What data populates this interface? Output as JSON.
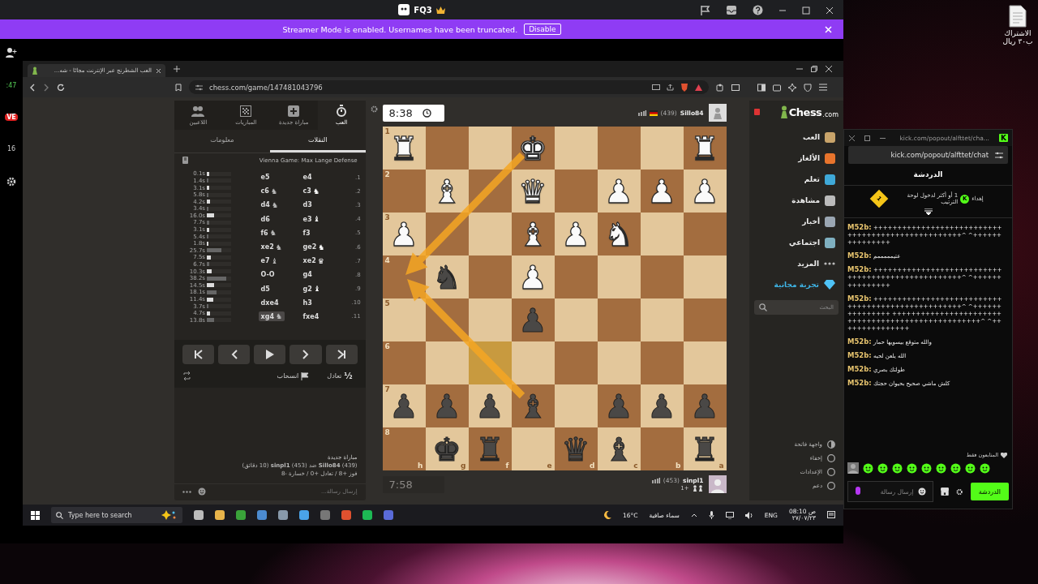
{
  "desktop_icon": {
    "label": "الاشتراك ب٣٠ ريال"
  },
  "app_window": {
    "title": "FQ3",
    "banner": {
      "text": "Streamer Mode is enabled. Usernames have been truncated.",
      "button": "Disable"
    },
    "rail": [
      {
        "kind": "time",
        "text": ":47"
      },
      {
        "kind": "live",
        "text": "VE"
      },
      {
        "kind": "count",
        "text": "16"
      }
    ]
  },
  "browser": {
    "tab_title": "العب الشطرنج عبر الإنترنت مجانًا - شه...",
    "url": "chess.com/game/147481043796"
  },
  "game_panel": {
    "nav": [
      {
        "label": "العب",
        "selected": true
      },
      {
        "label": "مباراة جديدة",
        "selected": false
      },
      {
        "label": "المباريات",
        "selected": false
      },
      {
        "label": "اللاعبين",
        "selected": false
      }
    ],
    "tabs": [
      {
        "label": "النقلات",
        "selected": true
      },
      {
        "label": "معلومات",
        "selected": false
      }
    ],
    "opening": "Vienna Game: Max Lange Defense",
    "moves": [
      {
        "number": "1.",
        "white": {
          "text": "e4",
          "selected": false
        },
        "black": {
          "text": "e5",
          "selected": false
        },
        "times": [
          {
            "text": "0.1s",
            "level": 0.1
          },
          {
            "text": "1.4s",
            "level": 0.05
          }
        ]
      },
      {
        "number": "2.",
        "white": {
          "text": "c3",
          "icon": "♞",
          "selected": false
        },
        "black": {
          "text": "c6",
          "icon": "♞",
          "selected": false
        },
        "times": [
          {
            "text": "3.1s",
            "level": 0.1
          },
          {
            "text": "5.8s",
            "level": 0.05
          }
        ]
      },
      {
        "number": "3.",
        "white": {
          "text": "d3",
          "selected": false
        },
        "black": {
          "text": "d4",
          "icon": "♞",
          "selected": false
        },
        "times": [
          {
            "text": "4.2s",
            "level": 0.12
          },
          {
            "text": "3.4s",
            "level": 0.05
          }
        ]
      },
      {
        "number": "4.",
        "white": {
          "text": "e3",
          "icon": "♝",
          "selected": false
        },
        "black": {
          "text": "d6",
          "selected": false
        },
        "times": [
          {
            "text": "16.0s",
            "level": 0.3
          },
          {
            "text": "7.7s",
            "level": 0.1
          }
        ]
      },
      {
        "number": "5.",
        "white": {
          "text": "f3",
          "selected": false
        },
        "black": {
          "text": "f6",
          "icon": "♞",
          "selected": false
        },
        "times": [
          {
            "text": "3.1s",
            "level": 0.1
          },
          {
            "text": "5.4s",
            "level": 0.05
          }
        ]
      },
      {
        "number": "6.",
        "white": {
          "text": "ge2",
          "icon": "♞",
          "selected": false
        },
        "black": {
          "text": "xe2",
          "icon": "♞",
          "selected": false
        },
        "times": [
          {
            "text": "1.8s",
            "level": 0.08
          },
          {
            "text": "25.7s",
            "level": 0.6
          }
        ]
      },
      {
        "number": "7.",
        "white": {
          "text": "xe2",
          "icon": "♛",
          "selected": false
        },
        "black": {
          "text": "e7",
          "icon": "♝",
          "selected": false
        },
        "times": [
          {
            "text": "7.5s",
            "level": 0.15
          },
          {
            "text": "6.7s",
            "level": 0.1
          }
        ]
      },
      {
        "number": "8.",
        "white": {
          "text": "g4",
          "selected": false
        },
        "black": {
          "text": "O-O",
          "selected": false
        },
        "times": [
          {
            "text": "10.3s",
            "level": 0.2
          },
          {
            "text": "38.2s",
            "level": 0.8
          }
        ]
      },
      {
        "number": "9.",
        "white": {
          "text": "g2",
          "icon": "♝",
          "selected": false
        },
        "black": {
          "text": "d5",
          "selected": false
        },
        "times": [
          {
            "text": "14.5s",
            "level": 0.3
          },
          {
            "text": "18.1s",
            "level": 0.4
          }
        ]
      },
      {
        "number": "10.",
        "white": {
          "text": "h3",
          "selected": false
        },
        "black": {
          "text": "dxe4",
          "selected": false
        },
        "times": [
          {
            "text": "11.4s",
            "level": 0.25
          },
          {
            "text": "3.7s",
            "level": 0.05
          }
        ]
      },
      {
        "number": "11.",
        "white": {
          "text": "fxe4",
          "selected": false
        },
        "black": {
          "text": "xg4",
          "icon": "♞",
          "selected": true
        },
        "times": [
          {
            "text": "4.7s",
            "level": 0.12
          },
          {
            "text": "13.8s",
            "level": 0.3
          }
        ]
      }
    ],
    "draw_icon": "½",
    "draw_label": "تعادل",
    "resign_label": "انسحاب",
    "game_info": {
      "title": "مباراة جديدة",
      "players": "**Sillo84** (439) ضد **sinpl1** (453) (10 دقائق)",
      "record": "فوز +8 / تعادل +0 / خسارة -8"
    },
    "chat_placeholder": "إرسال رسالة..."
  },
  "board": {
    "top_player": {
      "name": "Sillo84",
      "rating": "(439)",
      "clock": "8:38",
      "active": true
    },
    "bottom_player": {
      "name": "sinpl1",
      "rating": "(453)",
      "score": "1+",
      "clock": "7:58",
      "active": false
    },
    "ranks": [
      "1",
      "2",
      "3",
      "4",
      "5",
      "6",
      "7",
      "8"
    ],
    "files": [
      "a",
      "b",
      "c",
      "d",
      "e",
      "f",
      "g",
      "h"
    ],
    "squares": [
      [
        {
          "piece": "♜",
          "kind": "white",
          "highlighted": false
        },
        {
          "highlighted": false
        },
        {
          "highlighted": false
        },
        {
          "highlighted": false
        },
        {
          "piece": "♚",
          "kind": "white",
          "highlighted": false
        },
        {
          "highlighted": false
        },
        {
          "highlighted": false
        },
        {
          "piece": "♜",
          "kind": "white",
          "highlighted": false
        }
      ],
      [
        {
          "piece": "♟",
          "kind": "white",
          "highlighted": false
        },
        {
          "piece": "♟",
          "kind": "white",
          "highlighted": false
        },
        {
          "piece": "♟",
          "kind": "white",
          "highlighted": false
        },
        {
          "highlighted": false
        },
        {
          "piece": "♛",
          "kind": "white",
          "highlighted": false
        },
        {
          "highlighted": false
        },
        {
          "piece": "♝",
          "kind": "white",
          "highlighted": false
        },
        {
          "highlighted": false
        }
      ],
      [
        {
          "highlighted": false
        },
        {
          "highlighted": false
        },
        {
          "piece": "♞",
          "kind": "white",
          "highlighted": false
        },
        {
          "piece": "♟",
          "kind": "white",
          "highlighted": false
        },
        {
          "piece": "♝",
          "kind": "white",
          "highlighted": false
        },
        {
          "highlighted": false
        },
        {
          "highlighted": false
        },
        {
          "piece": "♟",
          "kind": "white",
          "highlighted": false
        }
      ],
      [
        {
          "highlighted": false
        },
        {
          "highlighted": false
        },
        {
          "highlighted": false
        },
        {
          "highlighted": false
        },
        {
          "piece": "♟",
          "kind": "white",
          "highlighted": false
        },
        {
          "highlighted": false
        },
        {
          "piece": "♞",
          "kind": "black",
          "highlighted": false
        },
        {
          "highlighted": false
        }
      ],
      [
        {
          "highlighted": false
        },
        {
          "highlighted": false
        },
        {
          "highlighted": false
        },
        {
          "highlighted": false
        },
        {
          "piece": "♟",
          "kind": "black",
          "highlighted": false
        },
        {
          "highlighted": false
        },
        {
          "highlighted": false
        },
        {
          "highlighted": false
        }
      ],
      [
        {
          "highlighted": false
        },
        {
          "highlighted": false
        },
        {
          "highlighted": false
        },
        {
          "highlighted": false
        },
        {
          "highlighted": false
        },
        {
          "highlighted": true
        },
        {
          "highlighted": false
        },
        {
          "highlighted": false
        }
      ],
      [
        {
          "piece": "♟",
          "kind": "black",
          "highlighted": false
        },
        {
          "piece": "♟",
          "kind": "black",
          "highlighted": false
        },
        {
          "piece": "♟",
          "kind": "black",
          "highlighted": false
        },
        {
          "highlighted": false
        },
        {
          "piece": "♝",
          "kind": "black",
          "highlighted": false
        },
        {
          "piece": "♟",
          "kind": "black",
          "highlighted": false
        },
        {
          "piece": "♟",
          "kind": "black",
          "highlighted": false
        },
        {
          "piece": "♟",
          "kind": "black",
          "highlighted": false
        }
      ],
      [
        {
          "piece": "♜",
          "kind": "black",
          "highlighted": false
        },
        {
          "highlighted": false
        },
        {
          "piece": "♝",
          "kind": "black",
          "highlighted": false
        },
        {
          "piece": "♛",
          "kind": "black",
          "highlighted": false
        },
        {
          "highlighted": false
        },
        {
          "piece": "♜",
          "kind": "black",
          "highlighted": false
        },
        {
          "piece": "♚",
          "kind": "black",
          "highlighted": false
        },
        {
          "highlighted": false
        }
      ]
    ]
  },
  "site_nav": {
    "logo": "Chess",
    "logo_suffix": ".com",
    "items": [
      {
        "label": "العب",
        "kind": "normal"
      },
      {
        "label": "الألغاز",
        "kind": "normal"
      },
      {
        "label": "تعلم",
        "kind": "normal"
      },
      {
        "label": "مشاهدة",
        "kind": "normal"
      },
      {
        "label": "أخبار",
        "kind": "normal"
      },
      {
        "label": "اجتماعي",
        "kind": "normal"
      },
      {
        "label": "المزيد",
        "kind": "more"
      },
      {
        "label": "تجربة مجانية",
        "kind": "promo"
      }
    ],
    "search_placeholder": "البحث",
    "footer": [
      "واجهة فاتحة",
      "إخفاء",
      "الإعدادات",
      "دعم"
    ]
  },
  "kick_chat": {
    "window_title": "kick.com/popout/alfttet/cha...",
    "logo": "K",
    "url": "kick.com/popout/alfttet/chat",
    "header": "الدردشة",
    "leaderboard": {
      "prefix": "إهداء",
      "coin": "K",
      "text": "1 أو أكثر لدخول لوحة الترتيب",
      "rank": "1"
    },
    "messages": [
      {
        "user": "M52b:",
        "text": "+++++++++++++++++++++++++++++++++++++++++++++++++++^ ^+++++++++++++++"
      },
      {
        "user": "M52b:",
        "text": "عتيمممممم"
      },
      {
        "user": "M52b:",
        "text": "+++++++++++++++++++++++++++++++++++++++++++++++++++^ ^+++++++++++++++"
      },
      {
        "user": "M52b:",
        "text": "+++++++++++++++++++++++++++++++++++++++++++++++++++^ ^+++++++++++++++ +++++++++++++++++++++++++++++++++++++++++++++++++++^ ^+++++++++++++++"
      },
      {
        "user": "M52b:",
        "text": "والله متوقع بيسويها حمار"
      },
      {
        "user": "M52b:",
        "text": "الله يلعن لحيه"
      },
      {
        "user": "M52b:",
        "text": "طولتك بصري"
      },
      {
        "user": "M52b:",
        "text": "كلش ماشي صحيح بحيوان حجتك"
      }
    ],
    "followers_only": "المتابعون فقط",
    "input_placeholder": "إرسال رسالة",
    "send_button": "الدردشة"
  },
  "taskbar": {
    "search_placeholder": "Type here to search",
    "temperature": "16°C",
    "weather": "سماء صافية",
    "language": "ENG",
    "time": "08:10 ص",
    "date": "٢٧/٠٧/٢٣"
  }
}
